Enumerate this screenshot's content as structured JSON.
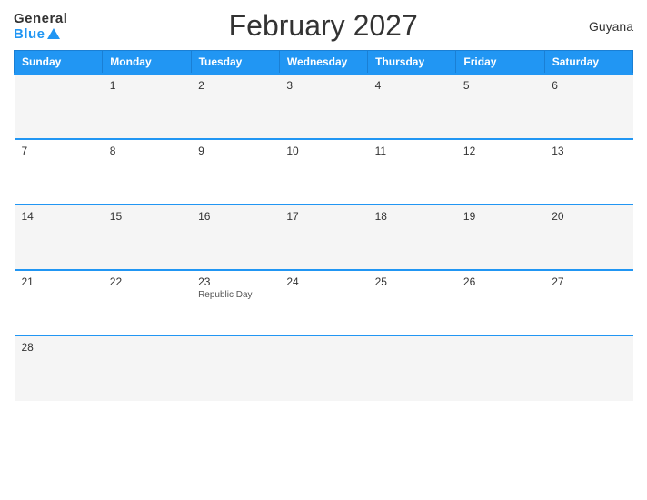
{
  "header": {
    "logo_general": "General",
    "logo_blue": "Blue",
    "title": "February 2027",
    "country": "Guyana"
  },
  "weekdays": [
    "Sunday",
    "Monday",
    "Tuesday",
    "Wednesday",
    "Thursday",
    "Friday",
    "Saturday"
  ],
  "weeks": [
    [
      {
        "day": "",
        "event": ""
      },
      {
        "day": "1",
        "event": ""
      },
      {
        "day": "2",
        "event": ""
      },
      {
        "day": "3",
        "event": ""
      },
      {
        "day": "4",
        "event": ""
      },
      {
        "day": "5",
        "event": ""
      },
      {
        "day": "6",
        "event": ""
      }
    ],
    [
      {
        "day": "7",
        "event": ""
      },
      {
        "day": "8",
        "event": ""
      },
      {
        "day": "9",
        "event": ""
      },
      {
        "day": "10",
        "event": ""
      },
      {
        "day": "11",
        "event": ""
      },
      {
        "day": "12",
        "event": ""
      },
      {
        "day": "13",
        "event": ""
      }
    ],
    [
      {
        "day": "14",
        "event": ""
      },
      {
        "day": "15",
        "event": ""
      },
      {
        "day": "16",
        "event": ""
      },
      {
        "day": "17",
        "event": ""
      },
      {
        "day": "18",
        "event": ""
      },
      {
        "day": "19",
        "event": ""
      },
      {
        "day": "20",
        "event": ""
      }
    ],
    [
      {
        "day": "21",
        "event": ""
      },
      {
        "day": "22",
        "event": ""
      },
      {
        "day": "23",
        "event": "Republic Day"
      },
      {
        "day": "24",
        "event": ""
      },
      {
        "day": "25",
        "event": ""
      },
      {
        "day": "26",
        "event": ""
      },
      {
        "day": "27",
        "event": ""
      }
    ],
    [
      {
        "day": "28",
        "event": ""
      },
      {
        "day": "",
        "event": ""
      },
      {
        "day": "",
        "event": ""
      },
      {
        "day": "",
        "event": ""
      },
      {
        "day": "",
        "event": ""
      },
      {
        "day": "",
        "event": ""
      },
      {
        "day": "",
        "event": ""
      }
    ]
  ]
}
